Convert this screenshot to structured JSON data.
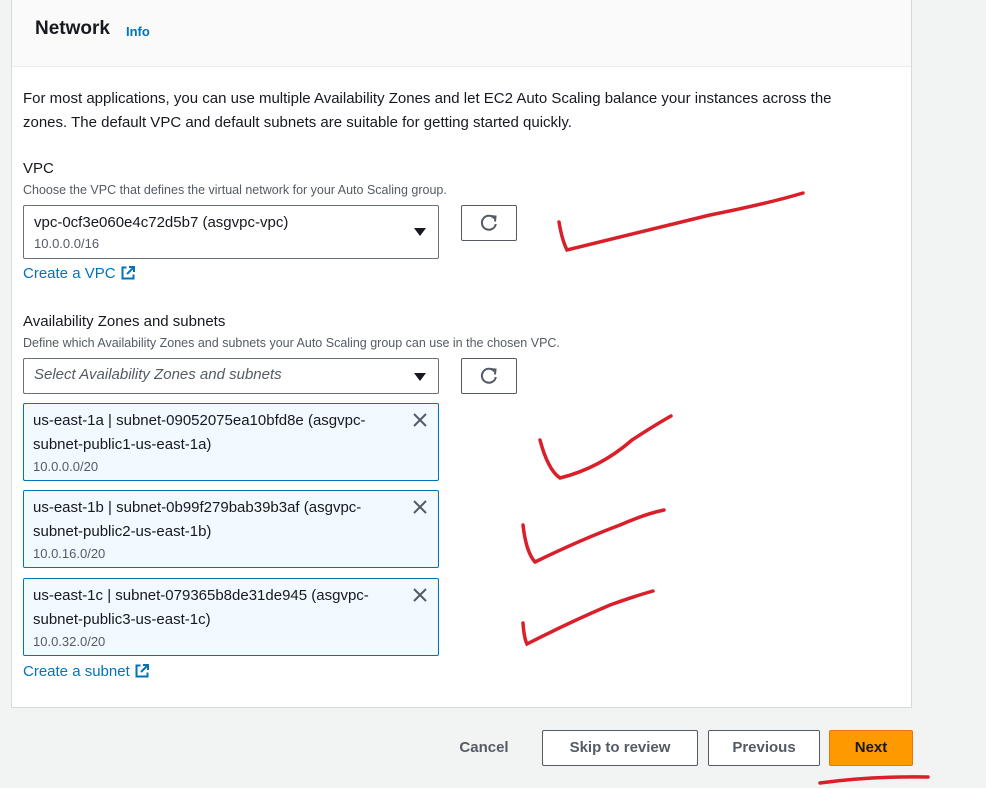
{
  "section": {
    "title": "Network",
    "info_label": "Info",
    "description": "For most applications, you can use multiple Availability Zones and let EC2 Auto Scaling balance your instances across the zones. The default VPC and default subnets are suitable for getting started quickly."
  },
  "vpc": {
    "label": "VPC",
    "help": "Choose the VPC that defines the virtual network for your Auto Scaling group.",
    "selected_name": "vpc-0cf3e060e4c72d5b7 (asgvpc-vpc)",
    "selected_cidr": "10.0.0.0/16",
    "create_link": "Create a VPC"
  },
  "subnets": {
    "label": "Availability Zones and subnets",
    "help": "Define which Availability Zones and subnets your Auto Scaling group can use in the chosen VPC.",
    "placeholder": "Select Availability Zones and subnets",
    "tokens": [
      {
        "line1": "us-east-1a | subnet-09052075ea10bfd8e (asgvpc-",
        "line2": "subnet-public1-us-east-1a)",
        "cidr": "10.0.0.0/20"
      },
      {
        "line1": "us-east-1b | subnet-0b99f279bab39b3af (asgvpc-",
        "line2": "subnet-public2-us-east-1b)",
        "cidr": "10.0.16.0/20"
      },
      {
        "line1": "us-east-1c | subnet-079365b8de31de945 (asgvpc-",
        "line2": "subnet-public3-us-east-1c)",
        "cidr": "10.0.32.0/20"
      }
    ],
    "create_link": "Create a subnet"
  },
  "footer": {
    "cancel": "Cancel",
    "skip": "Skip to review",
    "previous": "Previous",
    "next": "Next"
  },
  "colors": {
    "link": "#0073bb",
    "primary_button": "#ff9900",
    "token_bg": "#f1faff",
    "annotation_ink": "#d9202a"
  }
}
